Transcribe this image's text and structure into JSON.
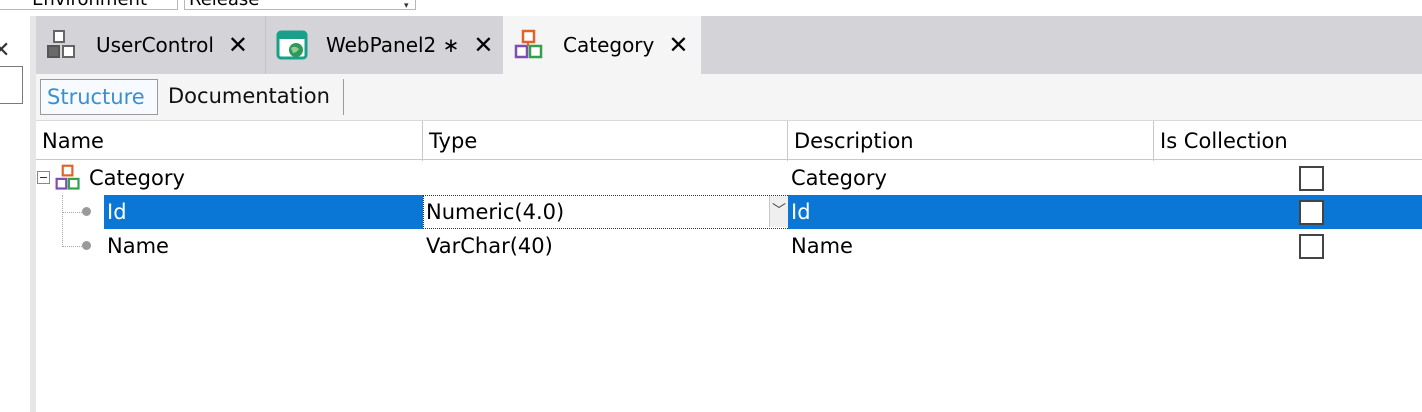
{
  "toolbar": {
    "environment_value": "Environment",
    "configuration_value": "Release"
  },
  "tabs": [
    {
      "label": "UserControl",
      "icon": "usercontrol-icon",
      "close": "✕"
    },
    {
      "label": "WebPanel2 ∗",
      "icon": "webpanel-icon",
      "close": "✕"
    },
    {
      "label": "Category",
      "icon": "structured-data-type-icon",
      "close": "✕",
      "active": true
    }
  ],
  "subtabs": {
    "structure": "Structure",
    "documentation": "Documentation"
  },
  "grid": {
    "columns": [
      "Name",
      "Type",
      "Description",
      "Is Collection"
    ],
    "rows": [
      {
        "name": "Category",
        "type": "",
        "description": "Category",
        "is_collection": false,
        "level": 0
      },
      {
        "name": "Id",
        "type": "Numeric(4.0)",
        "description": "Id",
        "is_collection": false,
        "level": 1,
        "selected": true
      },
      {
        "name": "Name",
        "type": "VarChar(40)",
        "description": "Name",
        "is_collection": false,
        "level": 1
      }
    ]
  },
  "colors": {
    "selection": "#0a76d6",
    "tab_strip": "#d4d4d8",
    "active_subtab_text": "#3a8fd4"
  }
}
